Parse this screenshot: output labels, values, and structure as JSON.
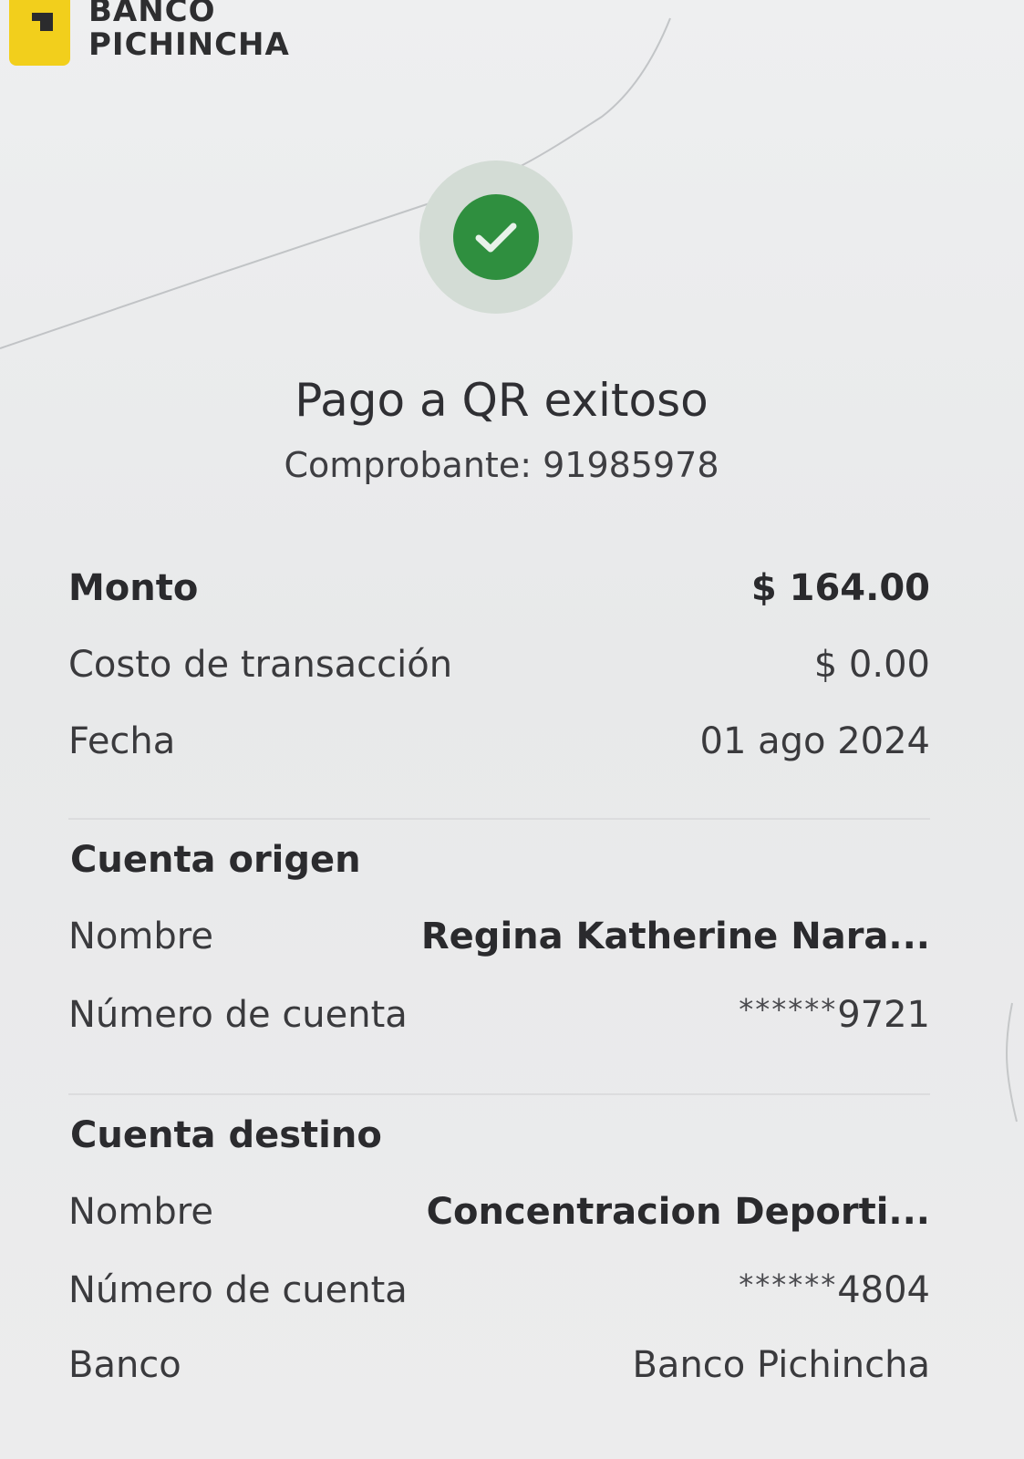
{
  "header": {
    "brand_line1": "BANCO",
    "brand_line2": "PICHINCHA",
    "brand_color": "#f2cf1c"
  },
  "status": {
    "icon": "check-icon",
    "color": "#2f8f3f",
    "title": "Pago a QR exitoso",
    "receipt_label": "Comprobante:",
    "receipt_number": "91985978"
  },
  "summary": {
    "amount_label": "Monto",
    "amount_value": "$ 164.00",
    "fee_label": "Costo de transacción",
    "fee_value": "$ 0.00",
    "date_label": "Fecha",
    "date_value": "01 ago 2024"
  },
  "origin": {
    "title": "Cuenta origen",
    "name_label": "Nombre",
    "name_value": "Regina Katherine Nara...",
    "account_label": "Número de cuenta",
    "account_mask": "******",
    "account_last4": "9721"
  },
  "destination": {
    "title": "Cuenta destino",
    "name_label": "Nombre",
    "name_value": "Concentracion Deporti...",
    "account_label": "Número de cuenta",
    "account_mask": "******",
    "account_last4": "4804",
    "bank_label": "Banco",
    "bank_value": "Banco Pichincha"
  }
}
